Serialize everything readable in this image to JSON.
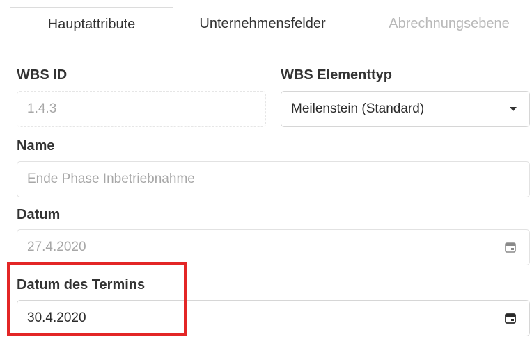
{
  "tabs": [
    {
      "label": "Hauptattribute",
      "active": true
    },
    {
      "label": "Unternehmensfelder",
      "active": false
    },
    {
      "label": "Abrechnungsebene",
      "active": false,
      "disabled": true
    }
  ],
  "form": {
    "wbs_id": {
      "label": "WBS ID",
      "value": "1.4.3"
    },
    "wbs_type": {
      "label": "WBS Elementtyp",
      "value": "Meilenstein (Standard)",
      "icon": "chevron-down-icon"
    },
    "name": {
      "label": "Name",
      "value": "Ende Phase Inbetriebnahme"
    },
    "date": {
      "label": "Datum",
      "value": "27.4.2020",
      "icon": "calendar-icon"
    },
    "appointment_date": {
      "label": "Datum des Termins",
      "value": "30.4.2020",
      "icon": "calendar-icon"
    }
  },
  "colors": {
    "highlight": "#e32626",
    "muted_text": "#a7a7a7",
    "border": "#e2e2e2"
  }
}
